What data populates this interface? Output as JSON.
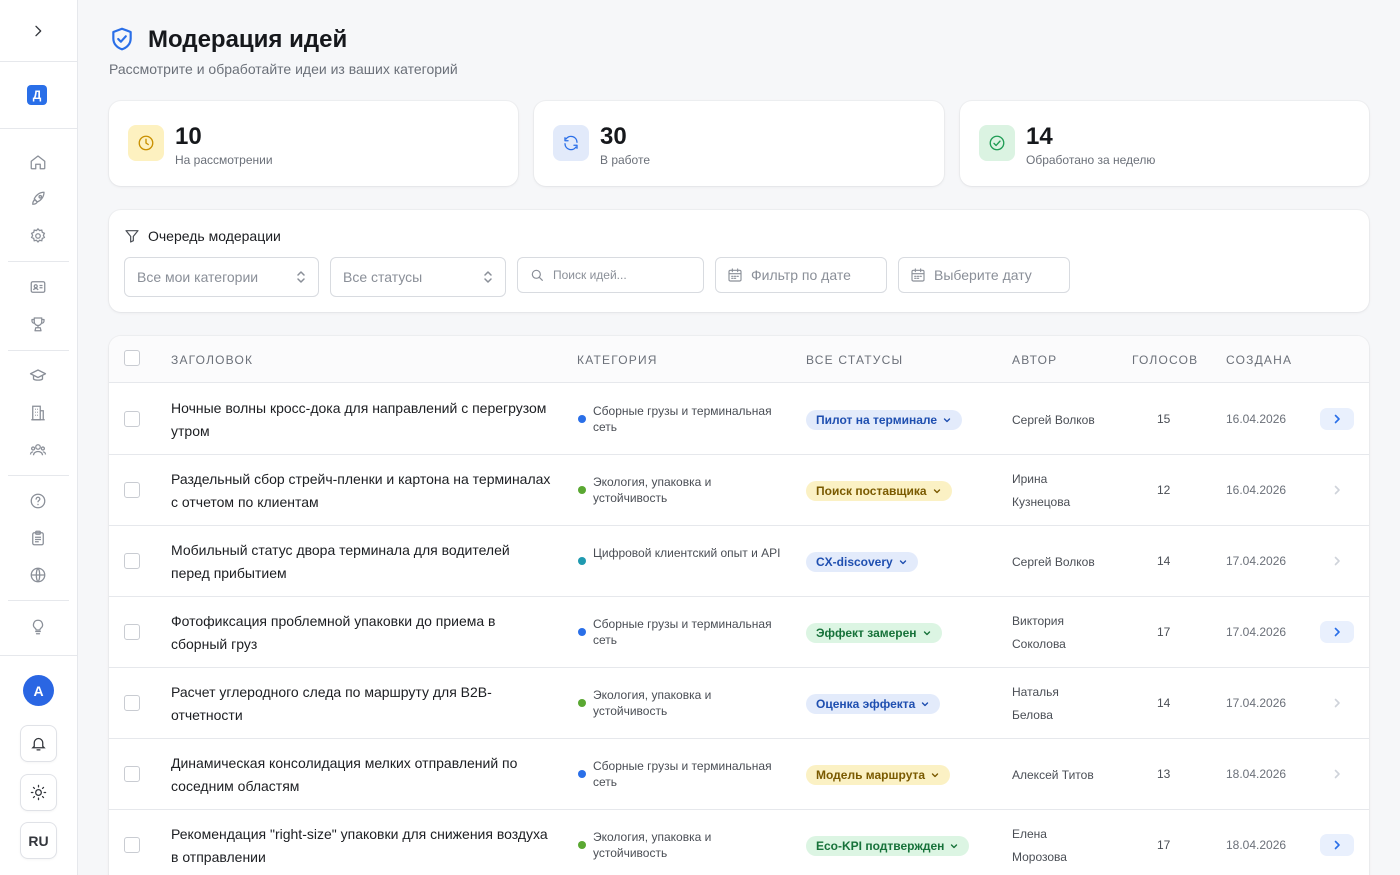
{
  "sidebar": {
    "workspace_badge": "Д",
    "avatar_initial": "А",
    "language": "RU"
  },
  "header": {
    "title": "Модерация идей",
    "subtitle": "Рассмотрите и обработайте идеи из ваших категорий"
  },
  "stats": [
    {
      "value": "10",
      "label": "На рассмотрении",
      "icon": "clock-icon",
      "color": "#f5b400"
    },
    {
      "value": "30",
      "label": "В работе",
      "icon": "refresh-icon",
      "color": "#2a6fe8"
    },
    {
      "value": "14",
      "label": "Обработано за неделю",
      "icon": "check-circle-icon",
      "color": "#1f9d55"
    }
  ],
  "filters": {
    "title": "Очередь модерации",
    "category_select": "Все мои категории",
    "status_select": "Все статусы",
    "search_placeholder": "Поиск идей...",
    "date_filter": "Фильтр по дате",
    "date_picker": "Выберите дату"
  },
  "table": {
    "columns": [
      "Заголовок",
      "Категория",
      "Все статусы",
      "Автор",
      "Голосов",
      "Создана"
    ],
    "rows": [
      {
        "title": "Ночные волны кросс-дока для направлений с перегрузом утром",
        "category": "Сборные грузы и терминальная сеть",
        "category_color": "#2a6fe8",
        "status": "Пилот на терминале",
        "status_tone": "blue",
        "author_line1": "Сергей Волков",
        "author_line2": "",
        "votes": "15",
        "created": "16.04.2026",
        "action_enabled": true
      },
      {
        "title": "Раздельный сбор стрейч-пленки и картона на терминалах с отчетом по клиентам",
        "category": "Экология, упаковка и устойчивость",
        "category_color": "#5aa832",
        "status": "Поиск поставщика",
        "status_tone": "yellow",
        "author_line1": "Ирина",
        "author_line2": "Кузнецова",
        "votes": "12",
        "created": "16.04.2026",
        "action_enabled": false
      },
      {
        "title": "Мобильный статус двора терминала для водителей перед прибытием",
        "category": "Цифровой клиентский опыт и API",
        "category_color": "#1f9ab0",
        "status": "CX-discovery",
        "status_tone": "blue",
        "author_line1": "Сергей Волков",
        "author_line2": "",
        "votes": "14",
        "created": "17.04.2026",
        "action_enabled": false
      },
      {
        "title": "Фотофиксация проблемной упаковки до приема в сборный груз",
        "category": "Сборные грузы и терминальная сеть",
        "category_color": "#2a6fe8",
        "status": "Эффект замерен",
        "status_tone": "green",
        "author_line1": "Виктория",
        "author_line2": "Соколова",
        "votes": "17",
        "created": "17.04.2026",
        "action_enabled": true
      },
      {
        "title": "Расчет углеродного следа по маршруту для B2B-отчетности",
        "category": "Экология, упаковка и устойчивость",
        "category_color": "#5aa832",
        "status": "Оценка эффекта",
        "status_tone": "blue",
        "author_line1": "Наталья",
        "author_line2": "Белова",
        "votes": "14",
        "created": "17.04.2026",
        "action_enabled": false
      },
      {
        "title": "Динамическая консолидация мелких отправлений по соседним областям",
        "category": "Сборные грузы и терминальная сеть",
        "category_color": "#2a6fe8",
        "status": "Модель маршрута",
        "status_tone": "yellow",
        "author_line1": "Алексей Титов",
        "author_line2": "",
        "votes": "13",
        "created": "18.04.2026",
        "action_enabled": false
      },
      {
        "title": "Рекомендация \"right-size\" упаковки для снижения воздуха в отправлении",
        "category": "Экология, упаковка и устойчивость",
        "category_color": "#5aa832",
        "status": "Eco-KPI подтвержден",
        "status_tone": "green",
        "author_line1": "Елена",
        "author_line2": "Морозова",
        "votes": "17",
        "created": "18.04.2026",
        "action_enabled": true
      }
    ]
  }
}
